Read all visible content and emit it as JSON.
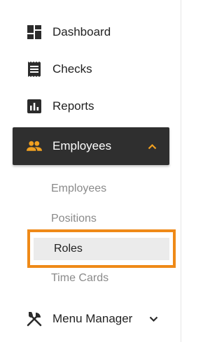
{
  "nav": {
    "dashboard": {
      "label": "Dashboard",
      "icon": "dashboard-icon"
    },
    "checks": {
      "label": "Checks",
      "icon": "receipt-icon"
    },
    "reports": {
      "label": "Reports",
      "icon": "bar-chart-icon"
    },
    "employees": {
      "label": "Employees",
      "icon": "people-icon",
      "expanded": true
    },
    "menu_manager": {
      "label": "Menu Manager",
      "icon": "utensils-icon",
      "expanded": false
    }
  },
  "employees_submenu": {
    "items": [
      {
        "label": "Employees"
      },
      {
        "label": "Positions"
      },
      {
        "label": "Roles",
        "selected": true
      },
      {
        "label": "Time Cards"
      }
    ]
  },
  "colors": {
    "accent": "#ef8a18",
    "active_bg": "#2f2f2f",
    "icon_accent": "#f0a020",
    "selected_bg": "#ebebeb"
  }
}
